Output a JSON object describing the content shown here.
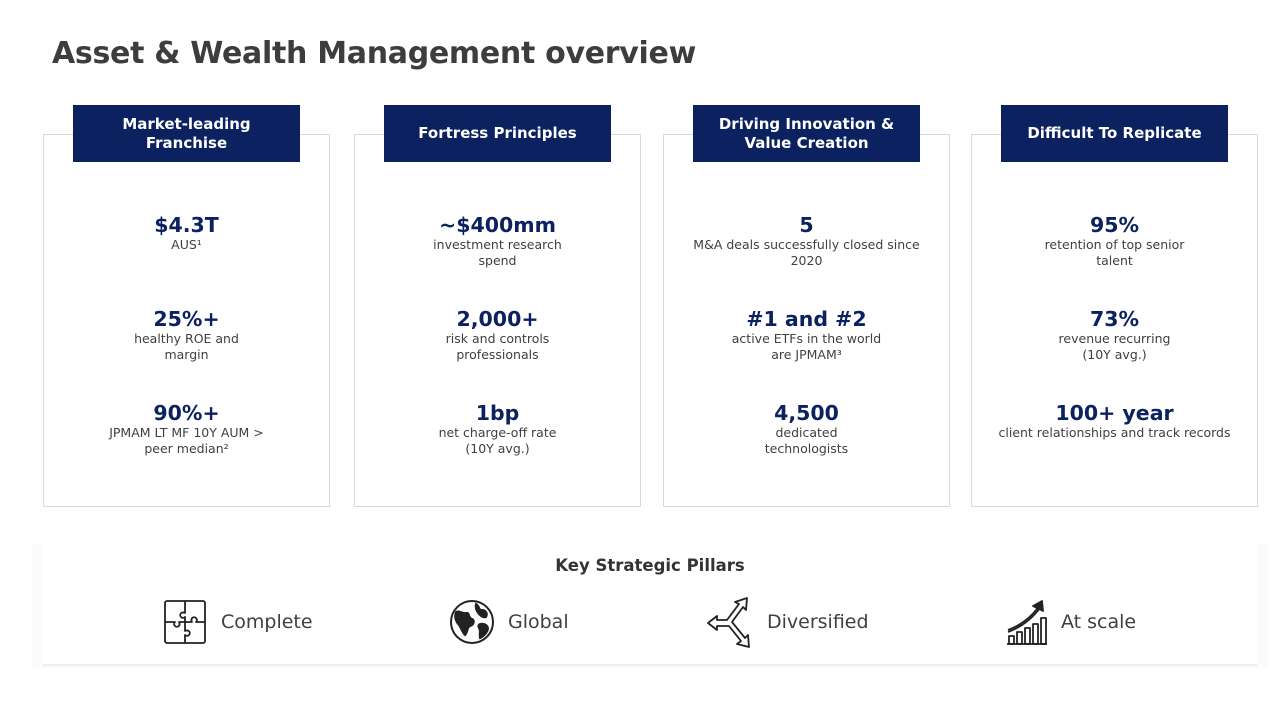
{
  "title": "Asset & Wealth Management overview",
  "cards": [
    {
      "header": "Market-leading Franchise",
      "stats": [
        {
          "value": "$4.3T",
          "desc": "AUS¹"
        },
        {
          "value": "25%+",
          "desc": "healthy ROE and margin"
        },
        {
          "value": "90%+",
          "desc": "JPMAM LT MF 10Y AUM > peer median²"
        }
      ]
    },
    {
      "header": "Fortress Principles",
      "stats": [
        {
          "value": "~$400mm",
          "desc": "investment research spend"
        },
        {
          "value": "2,000+",
          "desc": "risk and controls professionals"
        },
        {
          "value": "1bp",
          "desc": "net charge-off rate (10Y avg.)"
        }
      ]
    },
    {
      "header": "Driving Innovation & Value Creation",
      "stats": [
        {
          "value": "5",
          "desc": "M&A deals successfully closed since 2020"
        },
        {
          "value": "#1 and #2",
          "desc": "active ETFs in the world are JPMAM³"
        },
        {
          "value": "4,500",
          "desc": "dedicated technologists"
        }
      ]
    },
    {
      "header": "Difficult To Replicate",
      "stats": [
        {
          "value": "95%",
          "desc": "retention of top senior talent"
        },
        {
          "value": "73%",
          "desc": "revenue recurring (10Y avg.)"
        },
        {
          "value": "100+ year",
          "desc": "client relationships and track records"
        }
      ]
    }
  ],
  "pillars": {
    "title": "Key Strategic Pillars",
    "items": [
      {
        "label": "Complete",
        "icon": "puzzle-icon"
      },
      {
        "label": "Global",
        "icon": "globe-icon"
      },
      {
        "label": "Diversified",
        "icon": "three-arrows-icon"
      },
      {
        "label": "At scale",
        "icon": "growth-chart-icon"
      }
    ]
  },
  "colors": {
    "header_bg": "#0b2160",
    "value_text": "#0b2160",
    "title_text": "#3d3d3d"
  }
}
